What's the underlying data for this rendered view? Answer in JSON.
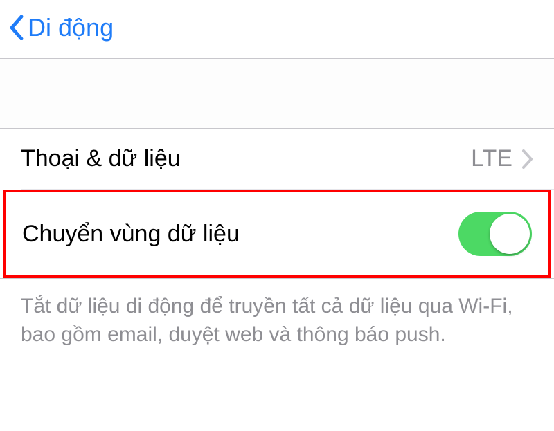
{
  "header": {
    "back_label": "Di động"
  },
  "rows": {
    "voice_data": {
      "label": "Thoại & dữ liệu",
      "value": "LTE"
    },
    "roaming": {
      "label": "Chuyển vùng dữ liệu",
      "enabled": true
    }
  },
  "footer": {
    "text": "Tắt dữ liệu di động để truyền tất cả dữ liệu qua Wi-Fi, bao gồm email, duyệt web và thông báo push."
  },
  "colors": {
    "accent": "#1f7cf8",
    "toggle_on": "#4cd964",
    "highlight": "#ff0000"
  }
}
